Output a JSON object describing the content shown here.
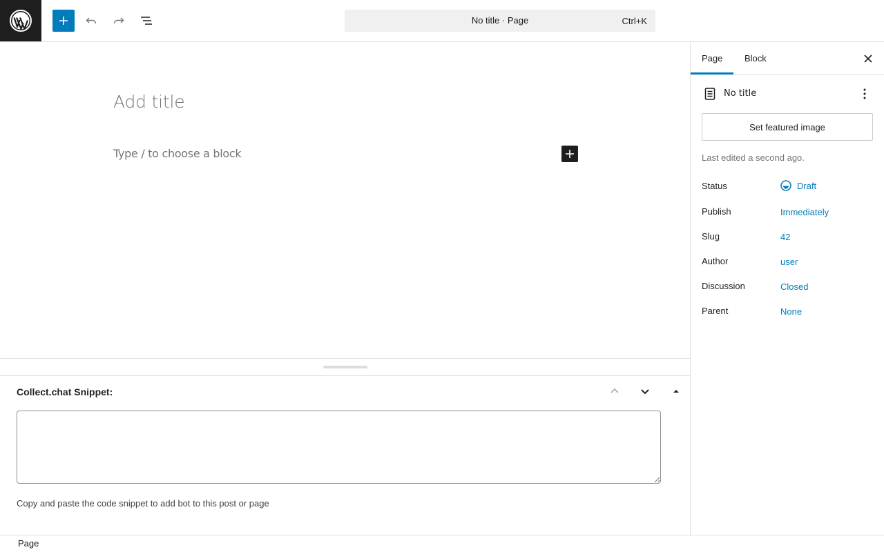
{
  "header": {
    "command_title": "No title · Page",
    "command_shortcut": "Ctrl+K"
  },
  "editor": {
    "title_placeholder": "Add title",
    "block_placeholder": "Type / to choose a block"
  },
  "metabox": {
    "title": "Collect.chat Snippet:",
    "textarea_value": "",
    "description": "Copy and paste the code snippet to add bot to this post or page"
  },
  "footer": {
    "breadcrumb": "Page"
  },
  "sidebar": {
    "tabs": [
      {
        "label": "Page",
        "active": true
      },
      {
        "label": "Block",
        "active": false
      }
    ],
    "document_title": "No title",
    "featured_image_label": "Set featured image",
    "last_edited": "Last edited a second ago.",
    "rows": [
      {
        "label": "Status",
        "value": "Draft"
      },
      {
        "label": "Publish",
        "value": "Immediately"
      },
      {
        "label": "Slug",
        "value": "42"
      },
      {
        "label": "Author",
        "value": "user"
      },
      {
        "label": "Discussion",
        "value": "Closed"
      },
      {
        "label": "Parent",
        "value": "None"
      }
    ]
  },
  "colors": {
    "accent": "#007cba",
    "dark": "#1e1e1e",
    "muted": "#757575",
    "border": "#e0e0e0"
  },
  "icons": [
    "wordpress-logo-icon",
    "plus-icon",
    "undo-icon",
    "redo-icon",
    "document-overview-icon",
    "close-icon",
    "page-icon",
    "more-vertical-icon",
    "draft-status-icon",
    "chevron-up-icon",
    "chevron-down-icon",
    "caret-up-icon"
  ]
}
